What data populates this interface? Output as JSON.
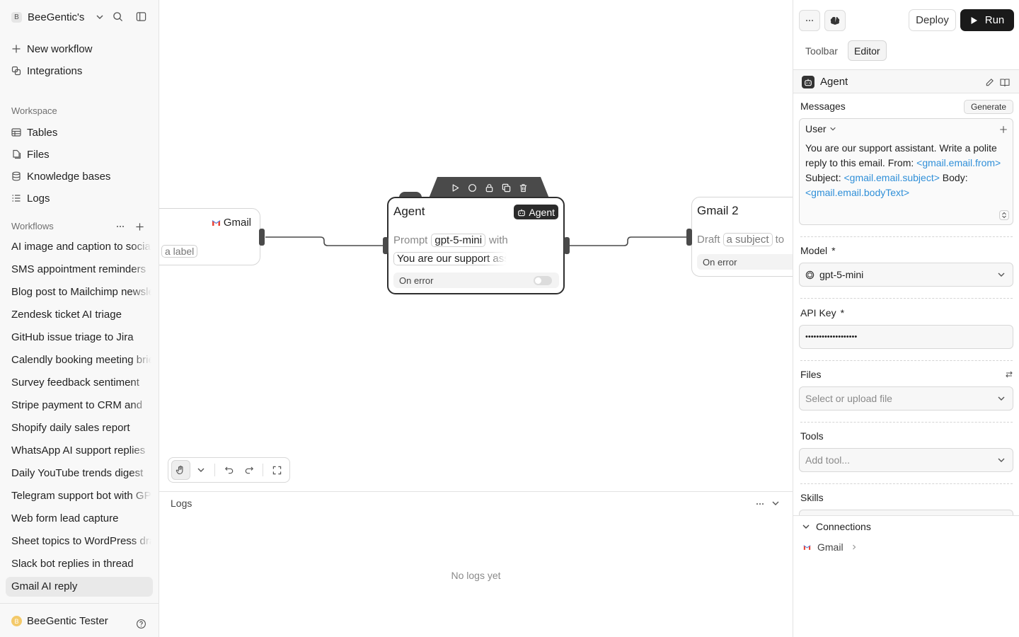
{
  "sidebar": {
    "workspace": {
      "badge": "B",
      "name": "BeeGentic's"
    },
    "nav": [
      {
        "label": "New workflow",
        "icon": "plus-icon"
      },
      {
        "label": "Integrations",
        "icon": "integrations-icon"
      }
    ],
    "workspace_section": "Workspace",
    "workspace_items": [
      {
        "label": "Tables",
        "icon": "table-icon"
      },
      {
        "label": "Files",
        "icon": "files-icon"
      },
      {
        "label": "Knowledge bases",
        "icon": "database-icon"
      },
      {
        "label": "Logs",
        "icon": "list-icon"
      }
    ],
    "workflows_section": "Workflows",
    "workflows": [
      {
        "label": "AI image and caption to social"
      },
      {
        "label": "SMS appointment reminders"
      },
      {
        "label": "Blog post to Mailchimp newsletter"
      },
      {
        "label": "Zendesk ticket AI triage"
      },
      {
        "label": "GitHub issue triage to Jira"
      },
      {
        "label": "Calendly booking meeting brief"
      },
      {
        "label": "Survey feedback sentiment"
      },
      {
        "label": "Stripe payment to CRM and"
      },
      {
        "label": "Shopify daily sales report"
      },
      {
        "label": "WhatsApp AI support replies"
      },
      {
        "label": "Daily YouTube trends digest"
      },
      {
        "label": "Telegram support bot with GPT"
      },
      {
        "label": "Web form lead capture"
      },
      {
        "label": "Sheet topics to WordPress drafts"
      },
      {
        "label": "Slack bot replies in thread"
      },
      {
        "label": "Gmail AI reply",
        "active": true
      }
    ],
    "user": {
      "initial": "B",
      "name": "BeeGentic Tester"
    }
  },
  "canvas": {
    "gmail_node": {
      "title": "Gmail",
      "chip": "a label",
      "prefix": "o"
    },
    "agent_node": {
      "title": "Agent",
      "badge": "Agent",
      "prompt_label": "Prompt",
      "model_chip": "gpt-5-mini",
      "with_label": "with",
      "prompt_chip": "You are our support assistant",
      "on_error": "On error"
    },
    "gmail2_node": {
      "title": "Gmail 2",
      "draft_label": "Draft",
      "subject_chip": "a subject",
      "to_label": "to",
      "on_error": "On error"
    }
  },
  "logs": {
    "title": "Logs",
    "empty": "No logs yet"
  },
  "panel": {
    "deploy": "Deploy",
    "run": "Run",
    "tabs": [
      "Toolbar",
      "Editor"
    ],
    "block_title": "Agent",
    "messages_label": "Messages",
    "generate": "Generate",
    "message_role": "User",
    "message_parts": [
      {
        "text": "You are our support assistant. Write a polite reply to this email. From: "
      },
      {
        "text": "<gmail.email.from>",
        "var": true
      },
      {
        "text": " Subject: "
      },
      {
        "text": "<gmail.email.subject>",
        "var": true
      },
      {
        "text": " Body: "
      },
      {
        "text": "<gmail.email.bodyText>",
        "var": true
      }
    ],
    "model_label": "Model",
    "model_value": "gpt-5-mini",
    "apikey_label": "API Key",
    "apikey_value": "•••••••••••••••••••",
    "files_label": "Files",
    "files_placeholder": "Select or upload file",
    "tools_label": "Tools",
    "tools_placeholder": "Add tool...",
    "skills_label": "Skills",
    "required_mark": "*",
    "connections_label": "Connections",
    "connection_item": "Gmail"
  },
  "colors": {
    "accent_variable": "#2f8fd8",
    "run_button": "#1a1a1a",
    "node_handle": "#4a4a4a"
  }
}
